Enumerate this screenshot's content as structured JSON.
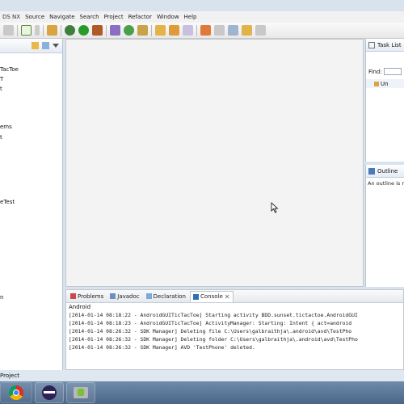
{
  "window": {
    "title_fragment": "DS NX"
  },
  "menu": [
    "Source",
    "Navigate",
    "Search",
    "Project",
    "Refactor",
    "Window",
    "Help"
  ],
  "explorer": {
    "items": [
      "TacToe",
      "T",
      "t",
      "ems",
      "t",
      "eTest",
      "n"
    ]
  },
  "task_list": {
    "title": "Task List",
    "find_label": "Find:",
    "uncategorized_label": "Un"
  },
  "outline": {
    "title": "Outline",
    "message": "An outline is n"
  },
  "bottom_tabs": [
    {
      "label": "Problems",
      "icon": "problems-icon",
      "active": false
    },
    {
      "label": "Javadoc",
      "icon": "javadoc-icon",
      "active": false
    },
    {
      "label": "Declaration",
      "icon": "declaration-icon",
      "active": false
    },
    {
      "label": "Console",
      "icon": "console-icon",
      "active": true
    }
  ],
  "console": {
    "title": "Android",
    "lines": [
      "[2014-01-14 08:18:22 - AndroidGUITicTacToe] Starting activity BDD.sunset.tictactoe.AndroidGUI",
      "[2014-01-14 08:18:23 - AndroidGUITicTacToe] ActivityManager: Starting: Intent { act=android",
      "[2014-01-14 08:26:32 - SDK Manager] Deleting file C:\\Users\\galbraithja\\.android\\avd\\TestPho",
      "[2014-01-14 08:26:32 - SDK Manager] Deleting folder C:\\Users\\galbraithja\\.android\\avd\\TestPho",
      "[2014-01-14 08:26:32 - SDK Manager] AVD 'TestPhone' deleted."
    ]
  },
  "status": {
    "text": "Project"
  },
  "taskbar": {
    "apps": [
      "chrome-icon",
      "eclipse-icon",
      "sdk-manager-icon"
    ]
  },
  "colors": {
    "accent": "#2f6fb3",
    "taskbar": "#58728f"
  }
}
